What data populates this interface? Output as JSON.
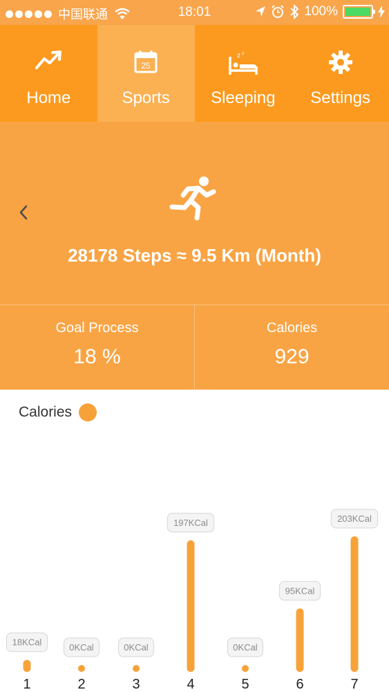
{
  "status_bar": {
    "carrier": "中国联通",
    "time": "18:01",
    "battery": "100%",
    "signal_icon": "signal-dots-icon",
    "wifi_icon": "wifi-icon"
  },
  "tabs": [
    {
      "label": "Home",
      "icon": "trend-line-icon"
    },
    {
      "label": "Sports",
      "icon": "calendar-icon",
      "calendar_day": "25"
    },
    {
      "label": "Sleeping",
      "icon": "bed-icon"
    },
    {
      "label": "Settings",
      "icon": "gear-icon"
    }
  ],
  "active_tab": "Sports",
  "hero": {
    "summary": "28178 Steps ≈ 9.5 Km (Month)",
    "icon": "runner-icon"
  },
  "stats": {
    "goal_label": "Goal Process",
    "goal_value": "18 %",
    "calories_label": "Calories",
    "calories_value": "929"
  },
  "chart_legend": {
    "label": "Calories",
    "color": "#f7a239"
  },
  "chart_data": {
    "type": "bar",
    "categories": [
      "1",
      "2",
      "3",
      "4",
      "5",
      "6",
      "7"
    ],
    "series": [
      {
        "name": "Calories",
        "values": [
          18,
          0,
          0,
          197,
          0,
          95,
          203
        ]
      }
    ],
    "data_labels": [
      "18KCal",
      "0KCal",
      "0KCal",
      "197KCal",
      "0KCal",
      "95KCal",
      "203KCal"
    ],
    "color": "#f7a239",
    "ylim": [
      0,
      203
    ]
  },
  "colors": {
    "tab_bg": "#fc9a1f",
    "tab_active_bg": "#fbb052",
    "hero_bg": "#f9a444",
    "battery_green": "#4cd964"
  }
}
